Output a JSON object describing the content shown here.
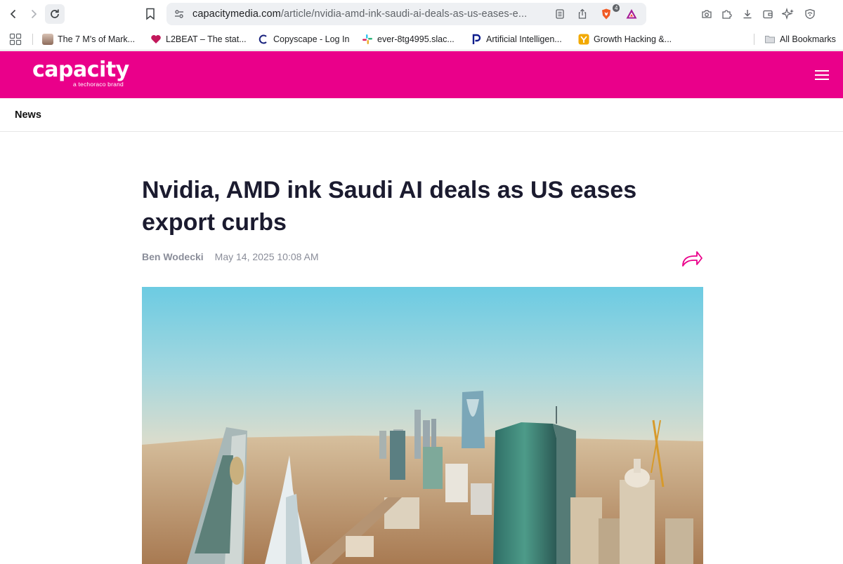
{
  "browser": {
    "url_host": "capacitymedia.com",
    "url_path": "/article/nvidia-amd-ink-saudi-ai-deals-as-us-eases-e...",
    "shield_badge": "4",
    "icons": [
      "back-icon",
      "forward-icon",
      "reload-icon",
      "bookmark-icon",
      "site-settings-icon",
      "reader-mode-icon",
      "share-icon",
      "brave-shield-icon",
      "brave-rewards-icon",
      "camera-icon",
      "extensions-icon",
      "download-icon",
      "wallet-icon",
      "leo-ai-icon",
      "vpn-icon"
    ]
  },
  "bookmarks": {
    "items": [
      {
        "label": "The 7 M's of Mark...",
        "icon": "avatar-icon",
        "color": "#b08d7a"
      },
      {
        "label": "L2BEAT – The stat...",
        "icon": "heart-icon",
        "color": "#c2185b"
      },
      {
        "label": "Copyscape - Log In",
        "icon": "copyscape-icon",
        "color": "#1a237e"
      },
      {
        "label": "ever-8tg4995.slac...",
        "icon": "slack-icon",
        "color": "#4a154b"
      },
      {
        "label": "Artificial Intelligen...",
        "icon": "p-icon",
        "color": "#0d1c8c"
      },
      {
        "label": "Growth Hacking &...",
        "icon": "y-icon",
        "color": "#f2a900"
      }
    ],
    "all_label": "All Bookmarks"
  },
  "site": {
    "brand": "capacity",
    "brand_sub": "a   techoraco brand",
    "brand_color": "#ea008a",
    "section": "News"
  },
  "article": {
    "title": "Nvidia, AMD ink Saudi AI deals as US eases export curbs",
    "author": "Ben Wodecki",
    "date": "May 14, 2025 10:08 AM"
  }
}
